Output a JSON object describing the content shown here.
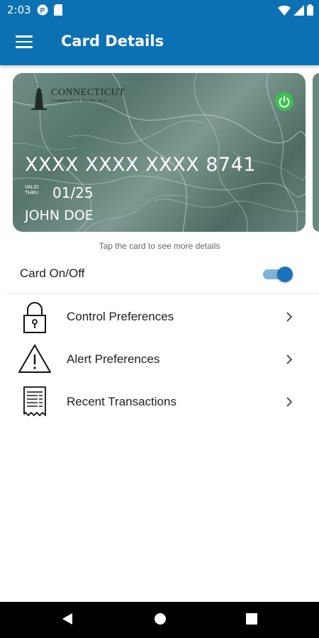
{
  "status_bar": {
    "time": "2:03",
    "left_icons": [
      "p-badge-icon",
      "sd-card-icon"
    ],
    "right_icons": [
      "wifi-icon",
      "signal-icon",
      "battery-icon"
    ]
  },
  "app_bar": {
    "title": "Card Details",
    "menu_icon": "hamburger-menu-icon",
    "color": "#0c71b2"
  },
  "card": {
    "bank_name_line1": "CONNECTICUT",
    "bank_name_line2": "COMMUNITY BANK, N.A.",
    "number": "XXXX XXXX XXXX 8741",
    "valid_thru_label": "VALID THRU",
    "valid_line1": "VALID",
    "valid_line2": "THRU",
    "expiry": "01/25",
    "holder": "JOHN DOE",
    "power_icon": "power-icon",
    "power_color": "#39c24a"
  },
  "tap_hint": "Tap the card to see more details",
  "card_toggle": {
    "label": "Card On/Off",
    "enabled": true,
    "accent": "#1a73b8"
  },
  "menu_items": [
    {
      "label": "Control Preferences",
      "icon": "padlock-icon"
    },
    {
      "label": "Alert Preferences",
      "icon": "warning-triangle-icon"
    },
    {
      "label": "Recent Transactions",
      "icon": "receipt-icon"
    }
  ],
  "nav_bar": {
    "buttons": [
      "back-icon",
      "home-icon",
      "recents-icon"
    ]
  }
}
